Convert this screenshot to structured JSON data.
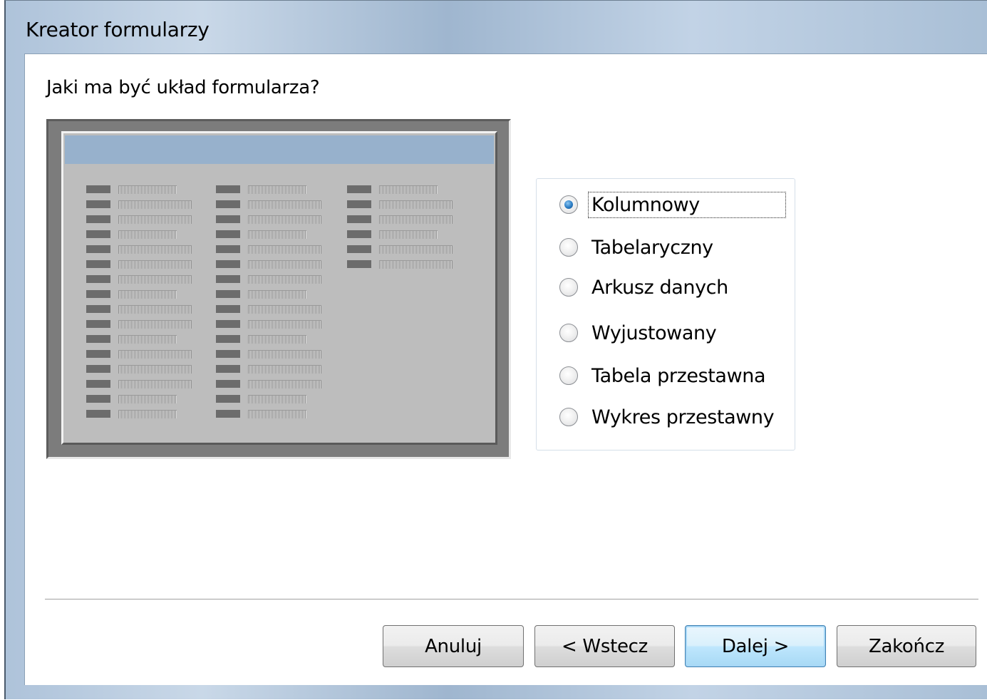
{
  "window": {
    "title": "Kreator formularzy"
  },
  "question": "Jaki ma być układ formularza?",
  "preview": {
    "columns": [
      {
        "rows": [
          "short",
          "long",
          "long",
          "short",
          "long",
          "long",
          "long",
          "short",
          "long",
          "long",
          "short",
          "long",
          "long",
          "long",
          "short",
          "short"
        ]
      },
      {
        "rows": [
          "short",
          "long",
          "long",
          "short",
          "long",
          "long",
          "long",
          "short",
          "long",
          "long",
          "short",
          "long",
          "long",
          "long",
          "short",
          "short"
        ]
      },
      {
        "rows": [
          "short",
          "long",
          "long",
          "short",
          "long",
          "long"
        ]
      }
    ]
  },
  "layout_options": [
    {
      "label": "Kolumnowy",
      "checked": true,
      "focused": true
    },
    {
      "label": "Tabelaryczny",
      "checked": false,
      "focused": false
    },
    {
      "label": "Arkusz danych",
      "checked": false,
      "focused": false
    },
    {
      "label": "Wyjustowany",
      "checked": false,
      "focused": false
    },
    {
      "label": "Tabela przestawna",
      "checked": false,
      "focused": false
    },
    {
      "label": "Wykres przestawny",
      "checked": false,
      "focused": false
    }
  ],
  "buttons": {
    "cancel": "Anuluj",
    "back": "< Wstecz",
    "next": "Dalej >",
    "finish": "Zakończ"
  }
}
